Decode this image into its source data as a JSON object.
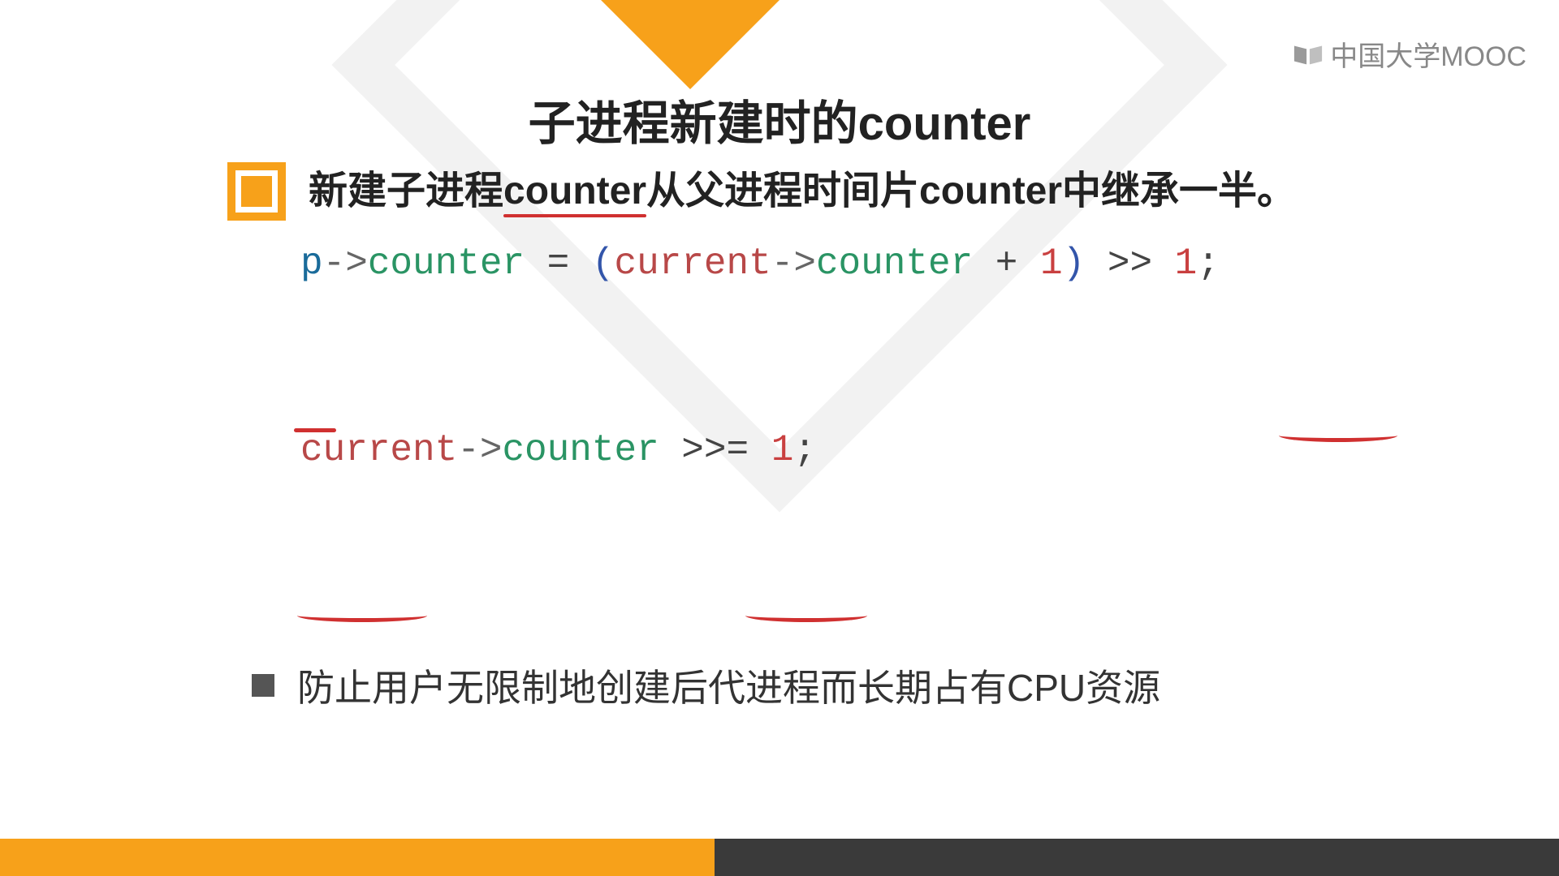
{
  "logo": {
    "text": "中国大学MOOC"
  },
  "title": "子进程新建时的counter",
  "main_bullet": {
    "prefix": "新建子进程",
    "underlined1": "counter",
    "mid": "从父进程时间片counter中继承一半。"
  },
  "code": {
    "line1": {
      "p": "p",
      "arrow1": "->",
      "counter1": "counter",
      "eq": " = ",
      "lparen": "(",
      "current": "current",
      "arrow2": "->",
      "counter2": "counter",
      "plus": " + ",
      "one1": "1",
      "rparen": ")",
      "shift": " >> ",
      "one2": "1",
      "semi": ";"
    },
    "line2": {
      "current": "current",
      "arrow": "->",
      "counter": "counter",
      "shifteq": " >>= ",
      "one": "1",
      "semi": ";"
    }
  },
  "sub_bullet": "防止用户无限制地创建后代进程而长期占有CPU资源"
}
